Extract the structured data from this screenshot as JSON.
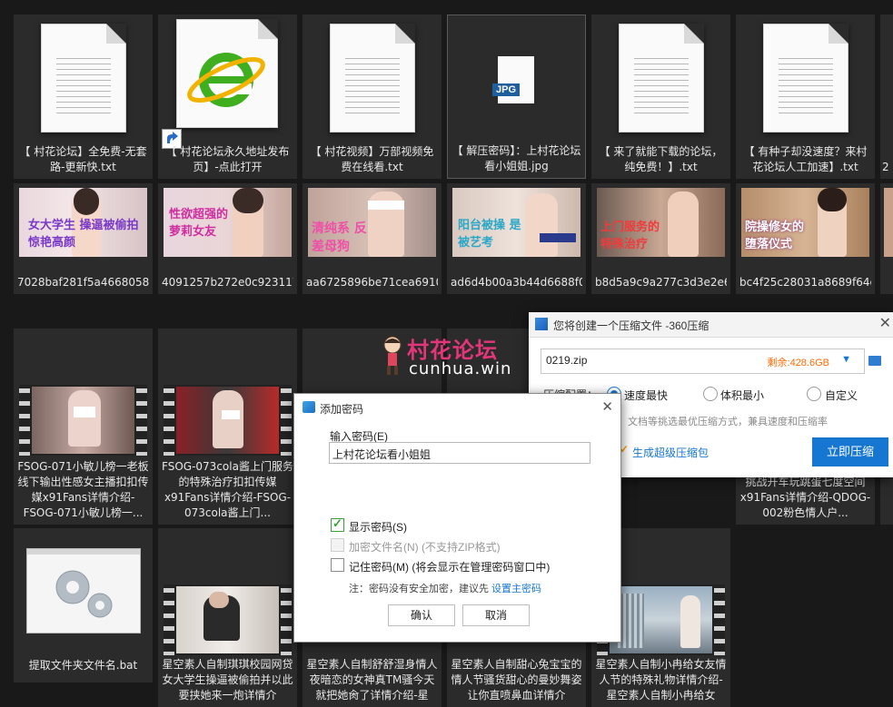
{
  "files_row1": [
    {
      "name": "【 村花论坛】全免费-无套路-更新快.txt",
      "type": "txt"
    },
    {
      "name": "【 村花论坛永久地址发布页】-点此打开",
      "type": "shortcut"
    },
    {
      "name": "【 村花视频】万部视频免费在线看.txt",
      "type": "txt"
    },
    {
      "name": "【 解压密码】：上村花论坛看小姐姐.jpg",
      "type": "jpg",
      "badge": "JPG"
    },
    {
      "name": "【 来了就能下载的论坛，纯免费！】.txt",
      "type": "txt"
    },
    {
      "name": "【 有种子却没速度？来村花论坛人工加速】.txt",
      "type": "txt"
    },
    {
      "name": "2",
      "type": "partial"
    }
  ],
  "files_row2": [
    {
      "name": "7028baf281f5a4668058d59bd556e22a.jpg",
      "overlay": "女大学生 操逼被偷拍 惊艳高颜",
      "brand": "星空传媒"
    },
    {
      "name": "4091257b272e0c9231174e4393327cd6.jpg",
      "overlay": "性欲超强的 萝莉女友",
      "brand": "JOKER"
    },
    {
      "name": "aa6725896be71cea6910cdf5e0c6b73f.jpg",
      "overlay": "清纯系 反差母狗",
      "brand": "星空"
    },
    {
      "name": "ad6d4b00a3b44d6688f0e2af47e96244.jpg",
      "overlay": "阳台被操 是被艺考",
      "brand": "JOKER"
    },
    {
      "name": "b8d5a9c9a277c3d3e2e6aee57824664e.jpg",
      "overlay": "上门服务的 特殊治疗",
      "brand": "JOKER"
    },
    {
      "name": "bc4f25c28031a8689f64e2eccb7a2ef6.jpg",
      "overlay": "院操修女的 堕落仪式",
      "brand": "JOKER"
    }
  ],
  "files_row3": [
    {
      "name": "FSOG-071小敏儿榜一老板线下输出性感女主播扣扣传媒x91Fans详情介绍-FSOG-071小敏儿榜一..."
    },
    {
      "name": "FSOG-073cola酱上门服务的特殊治疗扣扣传媒x91Fans详情介绍-FSOG-073cola酱上门..."
    },
    {
      "name": ""
    },
    {
      "name": ""
    },
    {
      "name": "挑战开车玩跳蛋七度空间x91Fans详情介绍-QDOG-002粉色情人户..."
    }
  ],
  "files_row4": [
    {
      "name": "提取文件夹文件名.bat"
    },
    {
      "name": "星空素人自制琪琪校园网贷女大学生操逼被偷拍并以此要挟她来一炮详情介"
    },
    {
      "name": "星空素人自制舒舒湿身情人夜暗恋的女神真TM骚今天就把她肏了详情介绍-星"
    },
    {
      "name": "星空素人自制甜心兔宝宝的情人节骚货甜心的曼妙舞姿让你直喷鼻血详情介"
    },
    {
      "name": "星空素人自制小冉给女友情人节的特殊礼物详情介绍-星空素人自制小冉给女"
    }
  ],
  "watermark": {
    "cn": "村花论坛",
    "en": "cunhua.win"
  },
  "zip_dialog": {
    "title": "您将创建一个压缩文件 -360压缩",
    "filename": "0219.zip",
    "remaining": "剩余:428.6GB",
    "config_label": "压缩配置：",
    "options": [
      "速度最快",
      "体积最小",
      "自定义"
    ],
    "hint": "、文档等挑选最优压缩方式，兼具速度和压缩率",
    "super_label": "生成超级压缩包",
    "submit": "立即压缩"
  },
  "pwd_dialog": {
    "title": "添加密码",
    "input_label": "输入密码(E)",
    "input_value": "上村花论坛看小姐姐",
    "show_pwd": "显示密码(S)",
    "encrypt_names": "加密文件名(N) (不支持ZIP格式)",
    "remember": "记住密码(M) (将会显示在管理密码窗口中)",
    "note": "注：密码没有安全加密，建议先",
    "note_link": "设置主密码",
    "ok": "确认",
    "cancel": "取消"
  },
  "colors": {
    "accent": "#1677d2",
    "orange": "#ff6a00",
    "panel": "#2b2b2b",
    "bg": "#191919"
  }
}
